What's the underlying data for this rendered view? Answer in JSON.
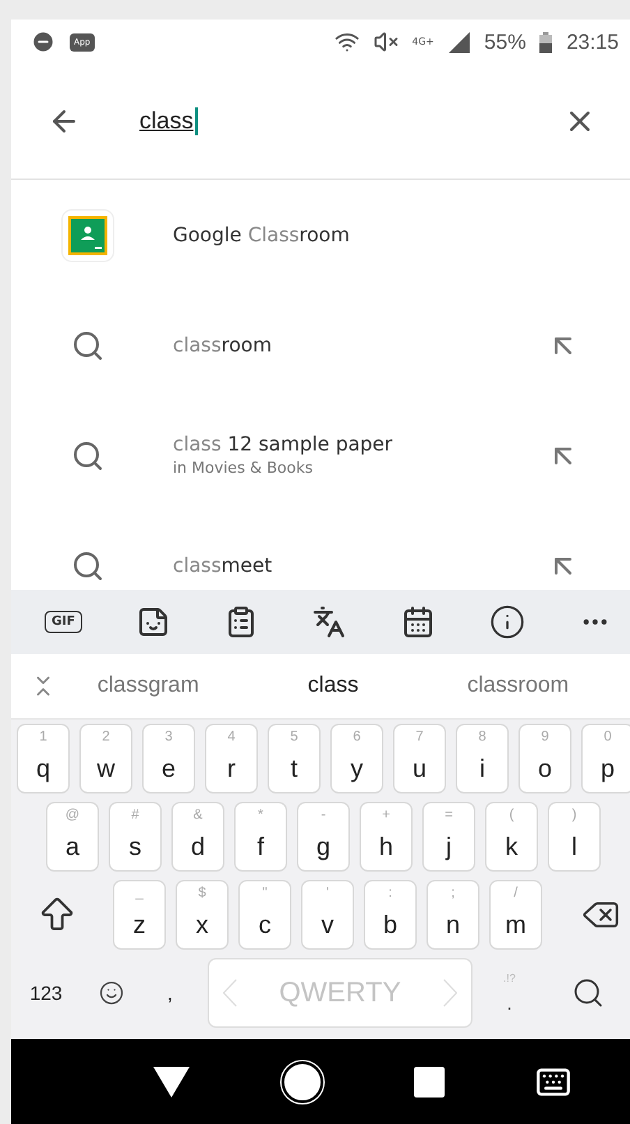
{
  "status_bar": {
    "app_badge": "App",
    "network": "4G+",
    "battery": "55%",
    "time": "23:15"
  },
  "search": {
    "value": "class"
  },
  "suggestions": [
    {
      "kind": "app",
      "text": "**Google** Class**room**"
    },
    {
      "kind": "query",
      "text": "class**room**"
    },
    {
      "kind": "query",
      "text": "class **12 sample paper**",
      "subtitle": "in Movies & Books"
    },
    {
      "kind": "query",
      "text": "class**meet**"
    }
  ],
  "keyboard_toolbar": {
    "gif_label": "GIF"
  },
  "word_suggestions": [
    {
      "text": "classgram",
      "selected": false
    },
    {
      "text": "class",
      "selected": true
    },
    {
      "text": "classroom",
      "selected": false
    }
  ],
  "keyboard": {
    "rows": [
      [
        {
          "label": "q",
          "hint": "1"
        },
        {
          "label": "w",
          "hint": "2"
        },
        {
          "label": "e",
          "hint": "3"
        },
        {
          "label": "r",
          "hint": "4"
        },
        {
          "label": "t",
          "hint": "5"
        },
        {
          "label": "y",
          "hint": "6"
        },
        {
          "label": "u",
          "hint": "7"
        },
        {
          "label": "i",
          "hint": "8"
        },
        {
          "label": "o",
          "hint": "9"
        },
        {
          "label": "p",
          "hint": "0"
        }
      ],
      [
        {
          "label": "a",
          "hint": "@"
        },
        {
          "label": "s",
          "hint": "#"
        },
        {
          "label": "d",
          "hint": "&"
        },
        {
          "label": "f",
          "hint": "*"
        },
        {
          "label": "g",
          "hint": "-"
        },
        {
          "label": "h",
          "hint": "+"
        },
        {
          "label": "j",
          "hint": "="
        },
        {
          "label": "k",
          "hint": "("
        },
        {
          "label": "l",
          "hint": ")"
        }
      ],
      [
        {
          "label": "z",
          "hint": "_"
        },
        {
          "label": "x",
          "hint": "$"
        },
        {
          "label": "c",
          "hint": "\""
        },
        {
          "label": "v",
          "hint": "'"
        },
        {
          "label": "b",
          "hint": ":"
        },
        {
          "label": "n",
          "hint": ";"
        },
        {
          "label": "m",
          "hint": "/"
        }
      ]
    ],
    "numbers_key": "123",
    "comma_key": ",",
    "space_key": "QWERTY",
    "period_key": ".",
    "period_hint": ".!?"
  }
}
